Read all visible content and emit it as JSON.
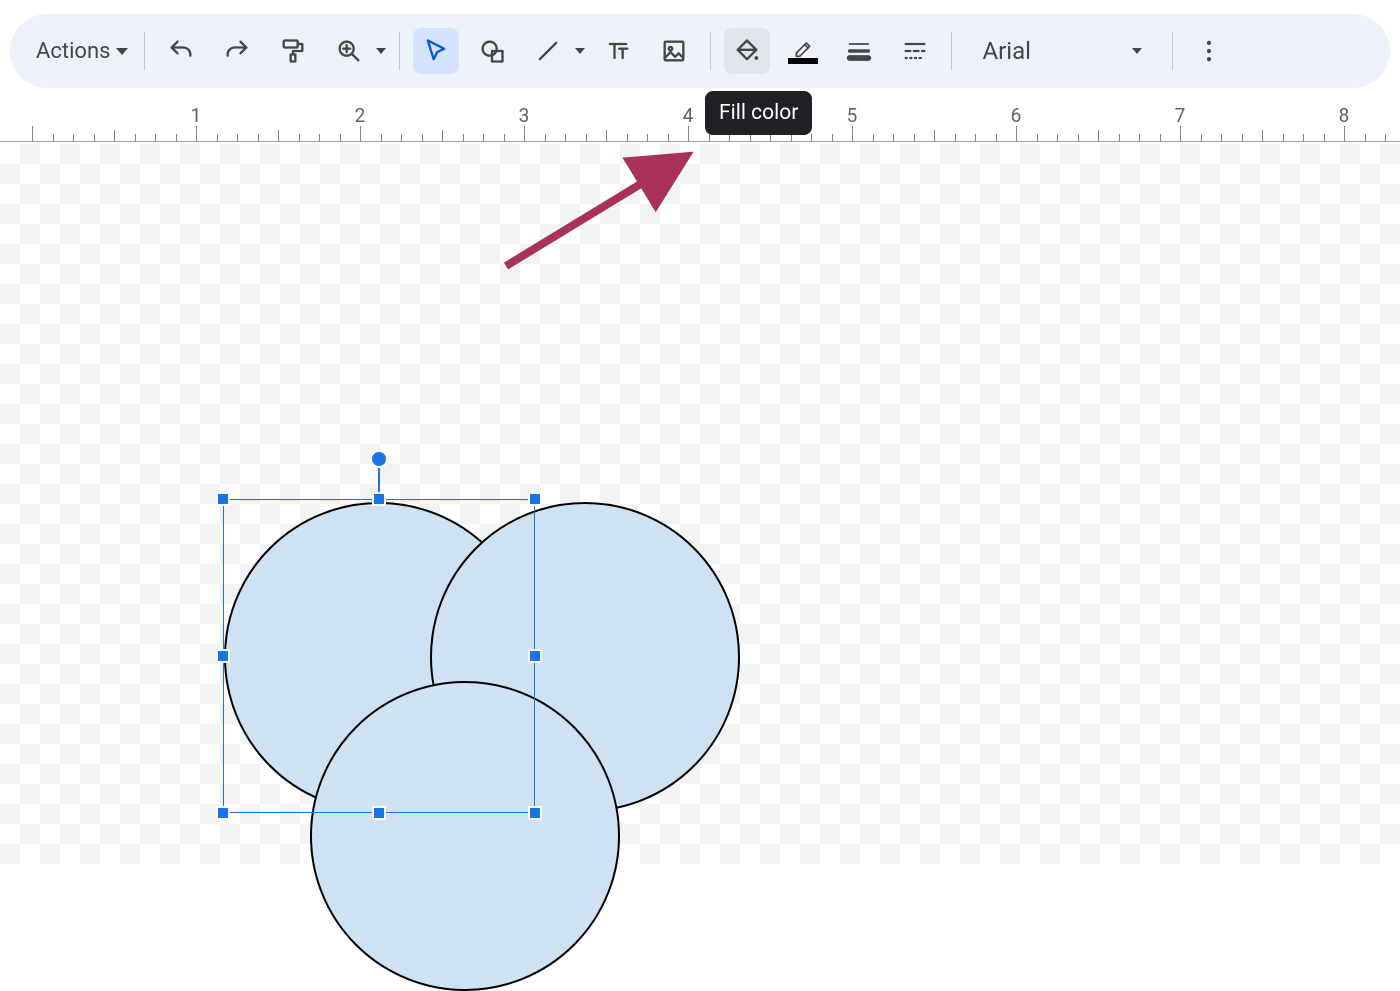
{
  "toolbar": {
    "actions_label": "Actions",
    "font": "Arial",
    "tooltip": "Fill color"
  },
  "ruler": {
    "labels": [
      "1",
      "2",
      "3",
      "4",
      "5",
      "6",
      "7",
      "8"
    ]
  },
  "shapes": {
    "fill": "#cfe2f3",
    "stroke": "#000000",
    "circles": [
      {
        "id": "c1",
        "selected": true
      },
      {
        "id": "c2",
        "selected": false
      },
      {
        "id": "c3",
        "selected": false
      }
    ]
  }
}
